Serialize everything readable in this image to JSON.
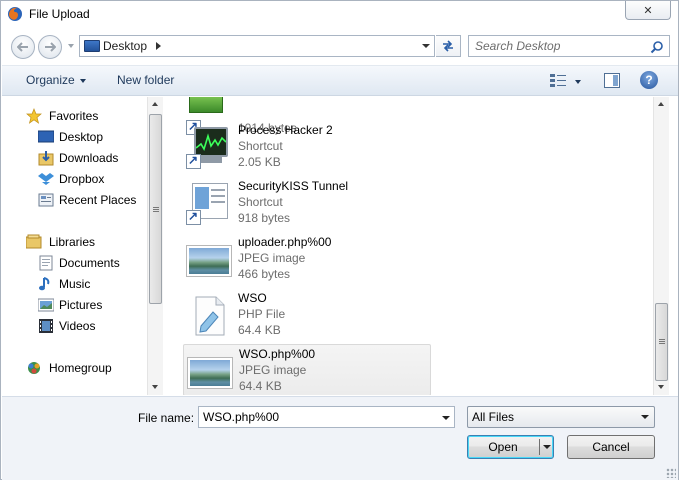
{
  "window": {
    "title": "File Upload",
    "close_label": "✕"
  },
  "address_bar": {
    "location": "Desktop"
  },
  "search": {
    "placeholder": "Search Desktop"
  },
  "toolbar": {
    "organize_label": "Organize",
    "new_folder_label": "New folder",
    "help_label": "?"
  },
  "nav": {
    "favorites": {
      "label": "Favorites",
      "items": [
        {
          "label": "Desktop",
          "icon": "desktop-icon"
        },
        {
          "label": "Downloads",
          "icon": "downloads-icon"
        },
        {
          "label": "Dropbox",
          "icon": "dropbox-icon"
        },
        {
          "label": "Recent Places",
          "icon": "recent-places-icon"
        }
      ]
    },
    "libraries": {
      "label": "Libraries",
      "items": [
        {
          "label": "Documents",
          "icon": "documents-icon"
        },
        {
          "label": "Music",
          "icon": "music-icon"
        },
        {
          "label": "Pictures",
          "icon": "pictures-icon"
        },
        {
          "label": "Videos",
          "icon": "videos-icon"
        }
      ]
    },
    "homegroup": {
      "label": "Homegroup"
    }
  },
  "files": [
    {
      "name": "",
      "type": "",
      "size": "1014 bytes",
      "icon": "shortcut-icon",
      "selected": false
    },
    {
      "name": "Process Hacker 2",
      "type": "Shortcut",
      "size": "2.05 KB",
      "icon": "process-hacker-icon",
      "selected": false
    },
    {
      "name": "SecurityKISS Tunnel",
      "type": "Shortcut",
      "size": "918 bytes",
      "icon": "securitykiss-icon",
      "selected": false
    },
    {
      "name": "uploader.php%00",
      "type": "JPEG image",
      "size": "466 bytes",
      "icon": "jpeg-image-icon",
      "selected": false
    },
    {
      "name": "WSO",
      "type": "PHP File",
      "size": "64.4 KB",
      "icon": "php-file-icon",
      "selected": false
    },
    {
      "name": "WSO.php%00",
      "type": "JPEG image",
      "size": "64.4 KB",
      "icon": "jpeg-image-icon",
      "selected": true
    }
  ],
  "bottom": {
    "file_name_label": "File name:",
    "file_name_value": "WSO.php%00",
    "filter_value": "All Files",
    "open_label": "Open",
    "cancel_label": "Cancel"
  },
  "colors": {
    "accent": "#1e395b",
    "selection": "#ececec",
    "toolbar_bg": "#dfe8f2"
  }
}
